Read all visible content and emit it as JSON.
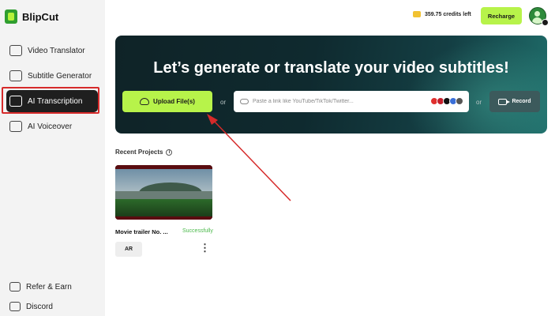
{
  "app": {
    "name": "BlipCut"
  },
  "sidebar": {
    "items": [
      {
        "label": "Video Translator",
        "icon": "video-translate-icon"
      },
      {
        "label": "Subtitle Generator",
        "icon": "subtitle-icon"
      },
      {
        "label": "AI Transcription",
        "icon": "transcription-icon",
        "active": true
      },
      {
        "label": "AI Voiceover",
        "icon": "voiceover-icon"
      }
    ],
    "bottom": [
      {
        "label": "Refer & Earn",
        "icon": "gift-icon"
      },
      {
        "label": "Discord",
        "icon": "discord-icon"
      }
    ]
  },
  "header": {
    "credits": "359.75 credits left",
    "recharge_label": "Recharge"
  },
  "hero": {
    "title": "Let’s generate or translate your video subtitles!",
    "upload_label": "Upload File(s)",
    "or1": "or",
    "link_placeholder": "Paste a link like YouTube/TikTok/Twitter...",
    "or2": "or",
    "record_label": "Record"
  },
  "recent": {
    "title": "Recent Projects",
    "projects": [
      {
        "name": "Movie trailer No. ...",
        "status": "Successfully",
        "language": "AR"
      }
    ]
  },
  "colors": {
    "accent": "#b7f34a",
    "highlight": "#d62a2a",
    "status_success": "#4ab94a"
  }
}
